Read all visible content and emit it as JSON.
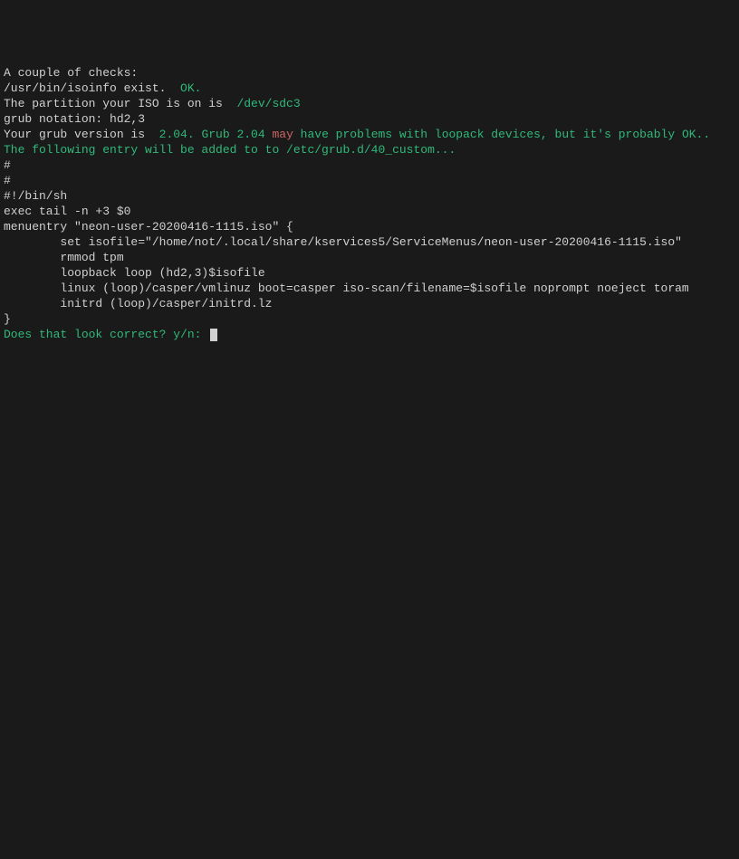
{
  "lines": {
    "l1": "A couple of checks:",
    "l2a": "/usr/bin/isoinfo exist.  ",
    "l2b": "OK.",
    "l3": "",
    "l4a": "The partition your ISO is on is  ",
    "l4b": "/dev/sdc3",
    "l5": "grub notation: hd2,3",
    "l6": "",
    "l7a": "Your grub version is  ",
    "l7b": "2.04. Grub 2.04 ",
    "l7c": "may",
    "l7d": " have problems with loopack devices, but it's probably OK..",
    "l8": "",
    "l9": "The following entry will be added to to /etc/grub.d/40_custom...",
    "l10": "#",
    "l11": "#",
    "l12": "#!/bin/sh",
    "l13": "exec tail -n +3 $0",
    "l14": "menuentry \"neon-user-20200416-1115.iso\" {",
    "l15": "        set isofile=\"/home/not/.local/share/kservices5/ServiceMenus/neon-user-20200416-1115.iso\"",
    "l16": "        rmmod tpm",
    "l17": "        loopback loop (hd2,3)$isofile",
    "l18": "        linux (loop)/casper/vmlinuz boot=casper iso-scan/filename=$isofile noprompt noeject toram",
    "l19": "        initrd (loop)/casper/initrd.lz",
    "l20": "}",
    "l21": "Does that look correct? y/n: "
  }
}
